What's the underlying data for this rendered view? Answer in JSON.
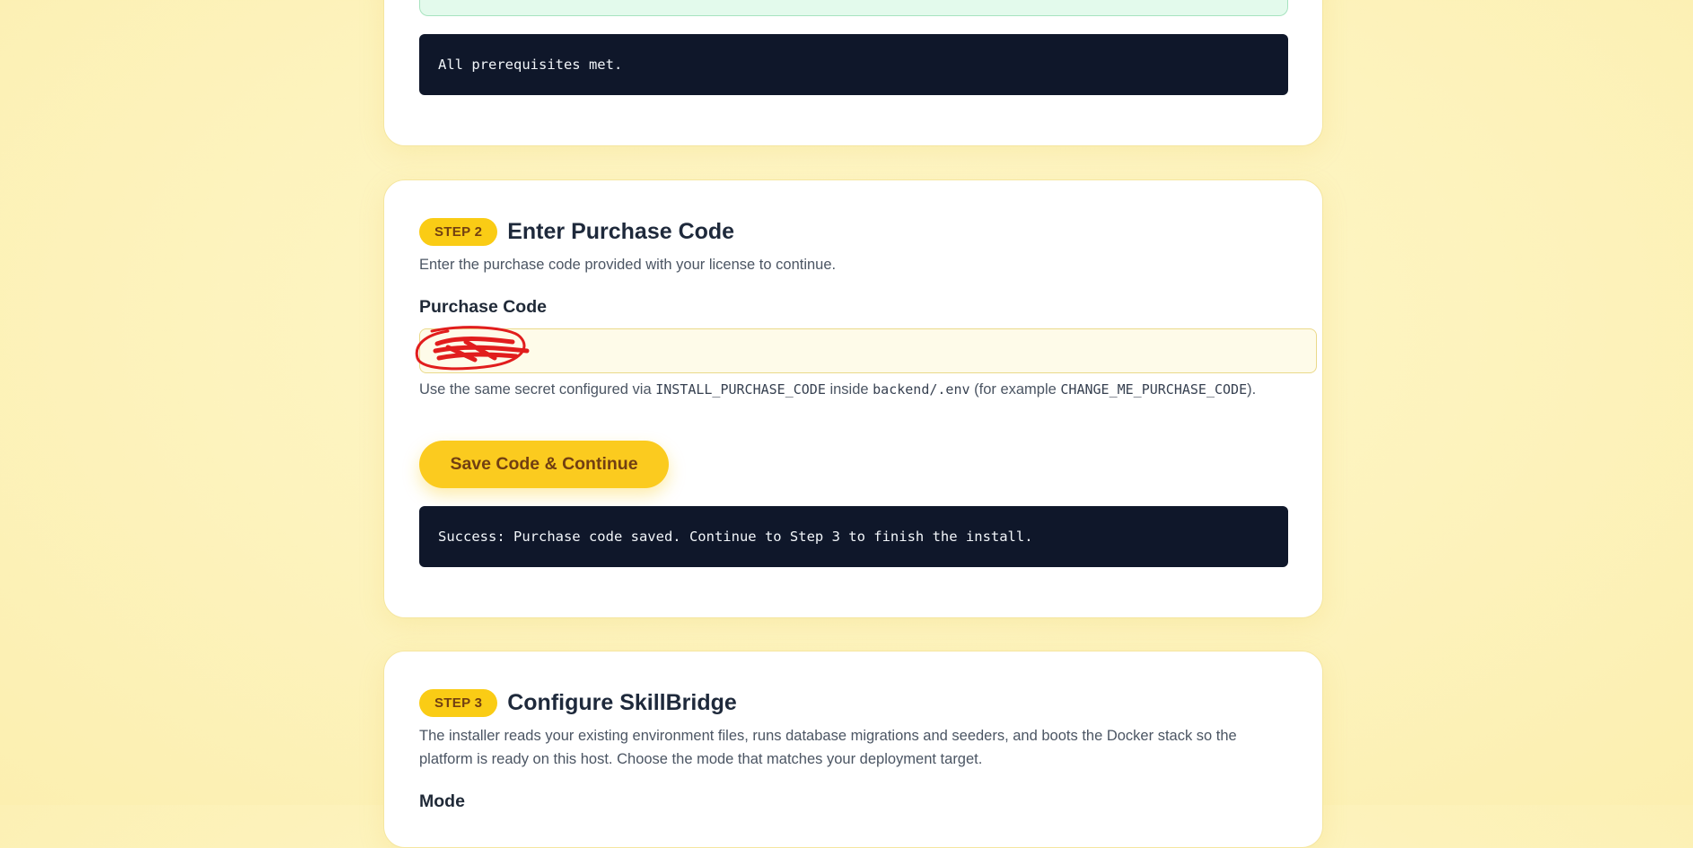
{
  "step1": {
    "console_output": "All prerequisites met."
  },
  "step2": {
    "badge": "STEP 2",
    "title": "Enter Purchase Code",
    "description": "Enter the purchase code provided with your license to continue.",
    "field_label": "Purchase Code",
    "field_value": "",
    "helper": {
      "prefix": "Use the same secret configured via ",
      "env_var": "INSTALL_PURCHASE_CODE",
      "middle": " inside ",
      "env_file": "backend/.env",
      "example_prefix": " (for example ",
      "example_value": "CHANGE_ME_PURCHASE_CODE",
      "suffix": ")."
    },
    "button_label": "Save Code & Continue",
    "console_output": "Success: Purchase code saved. Continue to Step 3 to finish the install."
  },
  "step3": {
    "badge": "STEP 3",
    "title": "Configure SkillBridge",
    "description": "The installer reads your existing environment files, runs database migrations and seeders, and boots the Docker stack so the platform is ready on this host. Choose the mode that matches your deployment target.",
    "mode_label": "Mode"
  },
  "colors": {
    "background": "#fdf3bd",
    "accent": "#facc15",
    "accent_text": "#713f12",
    "console_bg": "#0f172a",
    "success_strip": "#e3faec",
    "redaction": "#e11d1d"
  }
}
